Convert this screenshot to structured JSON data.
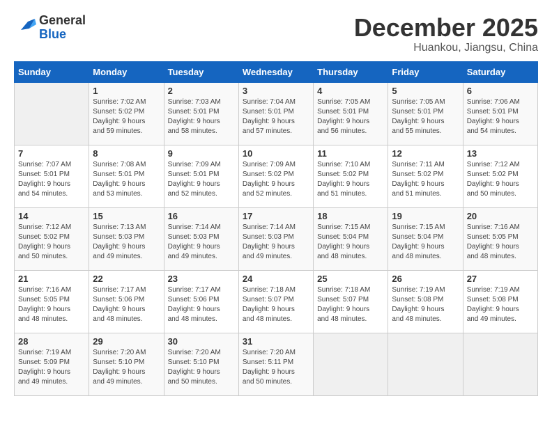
{
  "logo": {
    "text_general": "General",
    "text_blue": "Blue"
  },
  "title": {
    "month_year": "December 2025",
    "location": "Huankou, Jiangsu, China"
  },
  "days_of_week": [
    "Sunday",
    "Monday",
    "Tuesday",
    "Wednesday",
    "Thursday",
    "Friday",
    "Saturday"
  ],
  "weeks": [
    [
      {
        "day": "",
        "sunrise": "",
        "sunset": "",
        "daylight": ""
      },
      {
        "day": "1",
        "sunrise": "Sunrise: 7:02 AM",
        "sunset": "Sunset: 5:02 PM",
        "daylight": "Daylight: 9 hours and 59 minutes."
      },
      {
        "day": "2",
        "sunrise": "Sunrise: 7:03 AM",
        "sunset": "Sunset: 5:01 PM",
        "daylight": "Daylight: 9 hours and 58 minutes."
      },
      {
        "day": "3",
        "sunrise": "Sunrise: 7:04 AM",
        "sunset": "Sunset: 5:01 PM",
        "daylight": "Daylight: 9 hours and 57 minutes."
      },
      {
        "day": "4",
        "sunrise": "Sunrise: 7:05 AM",
        "sunset": "Sunset: 5:01 PM",
        "daylight": "Daylight: 9 hours and 56 minutes."
      },
      {
        "day": "5",
        "sunrise": "Sunrise: 7:05 AM",
        "sunset": "Sunset: 5:01 PM",
        "daylight": "Daylight: 9 hours and 55 minutes."
      },
      {
        "day": "6",
        "sunrise": "Sunrise: 7:06 AM",
        "sunset": "Sunset: 5:01 PM",
        "daylight": "Daylight: 9 hours and 54 minutes."
      }
    ],
    [
      {
        "day": "7",
        "sunrise": "Sunrise: 7:07 AM",
        "sunset": "Sunset: 5:01 PM",
        "daylight": "Daylight: 9 hours and 54 minutes."
      },
      {
        "day": "8",
        "sunrise": "Sunrise: 7:08 AM",
        "sunset": "Sunset: 5:01 PM",
        "daylight": "Daylight: 9 hours and 53 minutes."
      },
      {
        "day": "9",
        "sunrise": "Sunrise: 7:09 AM",
        "sunset": "Sunset: 5:01 PM",
        "daylight": "Daylight: 9 hours and 52 minutes."
      },
      {
        "day": "10",
        "sunrise": "Sunrise: 7:09 AM",
        "sunset": "Sunset: 5:02 PM",
        "daylight": "Daylight: 9 hours and 52 minutes."
      },
      {
        "day": "11",
        "sunrise": "Sunrise: 7:10 AM",
        "sunset": "Sunset: 5:02 PM",
        "daylight": "Daylight: 9 hours and 51 minutes."
      },
      {
        "day": "12",
        "sunrise": "Sunrise: 7:11 AM",
        "sunset": "Sunset: 5:02 PM",
        "daylight": "Daylight: 9 hours and 51 minutes."
      },
      {
        "day": "13",
        "sunrise": "Sunrise: 7:12 AM",
        "sunset": "Sunset: 5:02 PM",
        "daylight": "Daylight: 9 hours and 50 minutes."
      }
    ],
    [
      {
        "day": "14",
        "sunrise": "Sunrise: 7:12 AM",
        "sunset": "Sunset: 5:02 PM",
        "daylight": "Daylight: 9 hours and 50 minutes."
      },
      {
        "day": "15",
        "sunrise": "Sunrise: 7:13 AM",
        "sunset": "Sunset: 5:03 PM",
        "daylight": "Daylight: 9 hours and 49 minutes."
      },
      {
        "day": "16",
        "sunrise": "Sunrise: 7:14 AM",
        "sunset": "Sunset: 5:03 PM",
        "daylight": "Daylight: 9 hours and 49 minutes."
      },
      {
        "day": "17",
        "sunrise": "Sunrise: 7:14 AM",
        "sunset": "Sunset: 5:03 PM",
        "daylight": "Daylight: 9 hours and 49 minutes."
      },
      {
        "day": "18",
        "sunrise": "Sunrise: 7:15 AM",
        "sunset": "Sunset: 5:04 PM",
        "daylight": "Daylight: 9 hours and 48 minutes."
      },
      {
        "day": "19",
        "sunrise": "Sunrise: 7:15 AM",
        "sunset": "Sunset: 5:04 PM",
        "daylight": "Daylight: 9 hours and 48 minutes."
      },
      {
        "day": "20",
        "sunrise": "Sunrise: 7:16 AM",
        "sunset": "Sunset: 5:05 PM",
        "daylight": "Daylight: 9 hours and 48 minutes."
      }
    ],
    [
      {
        "day": "21",
        "sunrise": "Sunrise: 7:16 AM",
        "sunset": "Sunset: 5:05 PM",
        "daylight": "Daylight: 9 hours and 48 minutes."
      },
      {
        "day": "22",
        "sunrise": "Sunrise: 7:17 AM",
        "sunset": "Sunset: 5:06 PM",
        "daylight": "Daylight: 9 hours and 48 minutes."
      },
      {
        "day": "23",
        "sunrise": "Sunrise: 7:17 AM",
        "sunset": "Sunset: 5:06 PM",
        "daylight": "Daylight: 9 hours and 48 minutes."
      },
      {
        "day": "24",
        "sunrise": "Sunrise: 7:18 AM",
        "sunset": "Sunset: 5:07 PM",
        "daylight": "Daylight: 9 hours and 48 minutes."
      },
      {
        "day": "25",
        "sunrise": "Sunrise: 7:18 AM",
        "sunset": "Sunset: 5:07 PM",
        "daylight": "Daylight: 9 hours and 48 minutes."
      },
      {
        "day": "26",
        "sunrise": "Sunrise: 7:19 AM",
        "sunset": "Sunset: 5:08 PM",
        "daylight": "Daylight: 9 hours and 48 minutes."
      },
      {
        "day": "27",
        "sunrise": "Sunrise: 7:19 AM",
        "sunset": "Sunset: 5:08 PM",
        "daylight": "Daylight: 9 hours and 49 minutes."
      }
    ],
    [
      {
        "day": "28",
        "sunrise": "Sunrise: 7:19 AM",
        "sunset": "Sunset: 5:09 PM",
        "daylight": "Daylight: 9 hours and 49 minutes."
      },
      {
        "day": "29",
        "sunrise": "Sunrise: 7:20 AM",
        "sunset": "Sunset: 5:10 PM",
        "daylight": "Daylight: 9 hours and 49 minutes."
      },
      {
        "day": "30",
        "sunrise": "Sunrise: 7:20 AM",
        "sunset": "Sunset: 5:10 PM",
        "daylight": "Daylight: 9 hours and 50 minutes."
      },
      {
        "day": "31",
        "sunrise": "Sunrise: 7:20 AM",
        "sunset": "Sunset: 5:11 PM",
        "daylight": "Daylight: 9 hours and 50 minutes."
      },
      {
        "day": "",
        "sunrise": "",
        "sunset": "",
        "daylight": ""
      },
      {
        "day": "",
        "sunrise": "",
        "sunset": "",
        "daylight": ""
      },
      {
        "day": "",
        "sunrise": "",
        "sunset": "",
        "daylight": ""
      }
    ]
  ]
}
